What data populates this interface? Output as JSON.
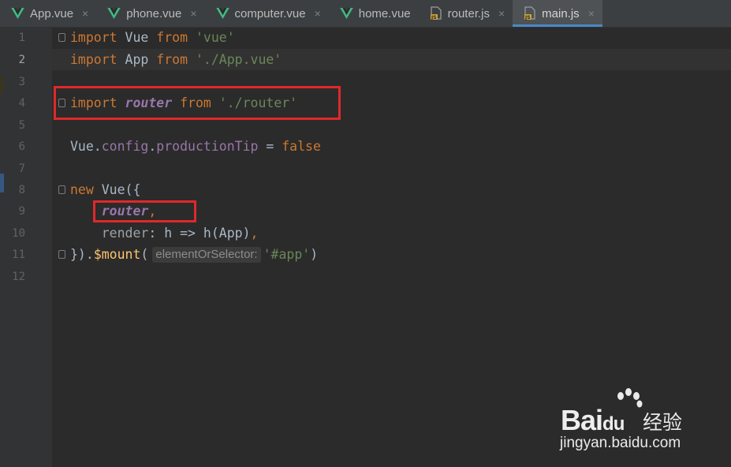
{
  "tabs": [
    {
      "label": "App.vue",
      "icon": "vue-icon",
      "active": false
    },
    {
      "label": "phone.vue",
      "icon": "vue-icon",
      "active": false
    },
    {
      "label": "computer.vue",
      "icon": "vue-icon",
      "active": false
    },
    {
      "label": "home.vue",
      "icon": "vue-icon",
      "active": false
    },
    {
      "label": "router.js",
      "icon": "js-file-icon",
      "active": false
    },
    {
      "label": "main.js",
      "icon": "js-file-icon",
      "active": true
    }
  ],
  "close_glyph": "×",
  "line_numbers": [
    "1",
    "2",
    "3",
    "4",
    "5",
    "6",
    "7",
    "8",
    "9",
    "10",
    "11",
    "12"
  ],
  "current_line": "2",
  "code": {
    "l1": {
      "kw1": "import",
      "name": " Vue ",
      "kw2": "from",
      "sp": " ",
      "str": "'vue'"
    },
    "l2": {
      "kw1": "import",
      "name": " App ",
      "kw2": "from",
      "sp": " ",
      "str": "'./App.vue'"
    },
    "l4": {
      "kw1": "import",
      "sp1": " ",
      "name": "router",
      "sp2": " ",
      "kw2": "from",
      "sp3": " ",
      "str": "'./router'"
    },
    "l6": {
      "obj": "Vue.",
      "prop1": "config",
      "dot": ".",
      "prop2": "productionTip",
      "eq": " = ",
      "val": "false"
    },
    "l8": {
      "kw": "new",
      "rest": " Vue({"
    },
    "l9": {
      "indent": "    ",
      "name": "router",
      "comma": ","
    },
    "l10": {
      "indent": "    ",
      "key": "render",
      "rest": ": h => h(App)",
      "comma": ","
    },
    "l11": {
      "close": "}).",
      "fn": "$mount",
      "paren": "(",
      "hint": "elementOrSelector:",
      "str": "'#app'",
      "end": ")"
    }
  },
  "colors": {
    "keyword": "#cc7832",
    "string": "#6a8759",
    "property": "#9876aa",
    "function": "#ffc66d",
    "default": "#a9b7c6",
    "highlight_box": "#e0282a",
    "active_tab_underline": "#4a88c7"
  },
  "watermark": {
    "brand": "Bai",
    "brand2": "du",
    "cn": "经验",
    "url": "jingyan.baidu.com"
  }
}
